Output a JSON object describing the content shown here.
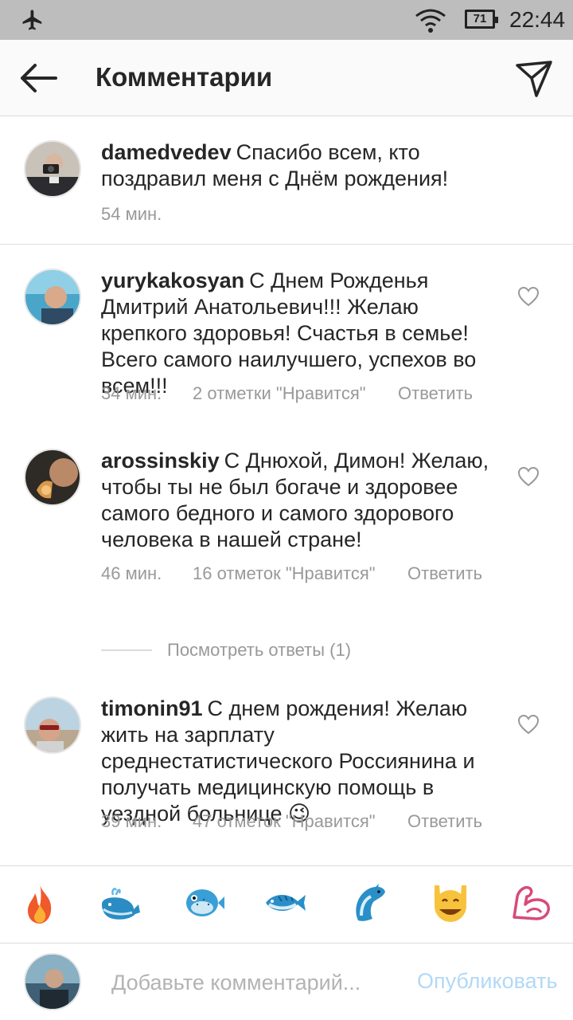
{
  "status_bar": {
    "battery": "71",
    "time": "22:44"
  },
  "header": {
    "title": "Комментарии"
  },
  "comments": [
    {
      "username": "damedvedev",
      "text": "Спасибо всем, кто поздравил меня с Днём рождения!",
      "time": "54 мин."
    },
    {
      "username": "yurykakosyan",
      "text": "С Днем Рожденья Дмитрий Анатольевич!!! Желаю крепкого здоровья! Счастья в семье! Всего самого наилучшего, успехов во всем!!!",
      "time": "34 мин.",
      "likes": "2 отметки \"Нравится\"",
      "reply": "Ответить"
    },
    {
      "username": "arossinskiy",
      "text": "С Днюхой, Димон! Желаю, чтобы ты не был богаче и здоровее самого бедного и самого здорового человека в нашей стране!",
      "time": "46 мин.",
      "likes": "16 отметок \"Нравится\"",
      "reply": "Ответить"
    },
    {
      "username": "timonin91",
      "text": "С днем рождения! Желаю жить на зарплату среднестатистического Россиянина и получать медицинскую помощь в уездной больнице 😉",
      "time": "39 мин.",
      "likes": "47 отметок \"Нравится\"",
      "reply": "Ответить"
    }
  ],
  "view_replies": "Посмотреть ответы (1)",
  "emoji_bar": [
    "fire-icon",
    "whale-icon",
    "blowfish-icon",
    "fish-icon",
    "dolphin-icon",
    "raised-hands-face-icon",
    "flexed-biceps-icon"
  ],
  "input": {
    "placeholder": "Добавьте комментарий...",
    "publish_label": "Опубликовать"
  },
  "colors": {
    "accent_disabled": "#b2d8f5",
    "meta_gray": "#999999",
    "text": "#262626"
  }
}
